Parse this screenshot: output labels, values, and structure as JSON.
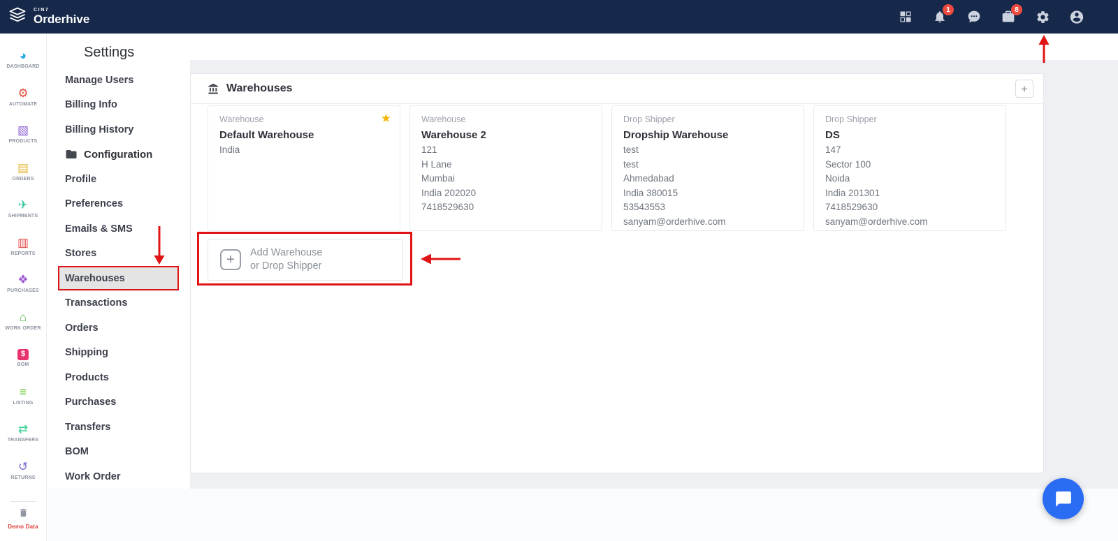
{
  "colors": {
    "topbar_bg": "#16294b",
    "annotation_red": "#e01414",
    "badge_red": "#ee4b40",
    "chat_widget_blue": "#2a6df4",
    "selected_item_bg": "#e4e4e5",
    "content_bg": "#eef0f4"
  },
  "topbar": {
    "brand_small": "CIN7",
    "brand": "Orderhive",
    "icons": [
      {
        "name": "apps-grid-icon"
      },
      {
        "name": "bell-icon",
        "badge": "1"
      },
      {
        "name": "chat-icon"
      },
      {
        "name": "package-icon",
        "badge": "8"
      },
      {
        "name": "gear-icon"
      },
      {
        "name": "account-icon"
      }
    ]
  },
  "rail": {
    "items": [
      {
        "label": "DASHBOARD",
        "icon": "dashboard-icon",
        "glyph": "◕",
        "color": "#2aabe4"
      },
      {
        "label": "AUTOMATE",
        "icon": "automate-icon",
        "glyph": "⚙",
        "color": "#e0533f"
      },
      {
        "label": "PRODUCTS",
        "icon": "products-icon",
        "glyph": "▧",
        "color": "#8b5fd6"
      },
      {
        "label": "ORDERS",
        "icon": "orders-icon",
        "glyph": "▤",
        "color": "#e8b93c"
      },
      {
        "label": "SHIPMENTS",
        "icon": "shipments-icon",
        "glyph": "✈",
        "color": "#35c4a4"
      },
      {
        "label": "REPORTS",
        "icon": "reports-icon",
        "glyph": "▥",
        "color": "#e34f4f"
      },
      {
        "label": "PURCHASES",
        "icon": "purchases-icon",
        "glyph": "❖",
        "color": "#9b59d0"
      },
      {
        "label": "WORK ORDER",
        "icon": "work-order-icon",
        "glyph": "⌂",
        "color": "#56b84b"
      },
      {
        "label": "BOM",
        "icon": "bom-icon",
        "glyph": "$",
        "color": "#e8356d"
      },
      {
        "label": "LISTING",
        "icon": "listing-icon",
        "glyph": "≡",
        "color": "#52c41a"
      },
      {
        "label": "TRANSFERS",
        "icon": "transfers-icon",
        "glyph": "⇄",
        "color": "#2ecc8f"
      },
      {
        "label": "RETURNS",
        "icon": "returns-icon",
        "glyph": "↺",
        "color": "#7c6bd8"
      }
    ],
    "demo": {
      "label": "Demo Data",
      "icon": "trash-icon",
      "color": "#e23b3b"
    }
  },
  "settings_nav": {
    "title": "Settings",
    "items": [
      {
        "label": "Manage Users"
      },
      {
        "label": "Billing Info"
      },
      {
        "label": "Billing History"
      },
      {
        "label": "Configuration",
        "icon": "folder-icon",
        "group": true
      },
      {
        "label": "Profile"
      },
      {
        "label": "Preferences"
      },
      {
        "label": "Emails & SMS"
      },
      {
        "label": "Stores"
      },
      {
        "label": "Warehouses",
        "selected": true
      },
      {
        "label": "Transactions"
      },
      {
        "label": "Orders"
      },
      {
        "label": "Shipping"
      },
      {
        "label": "Products"
      },
      {
        "label": "Purchases"
      },
      {
        "label": "Transfers"
      },
      {
        "label": "BOM"
      },
      {
        "label": "Work Order"
      }
    ]
  },
  "main": {
    "panel": {
      "title": "Warehouses",
      "icon": "warehouse-building-icon",
      "add_symbol": "+"
    },
    "cards": [
      {
        "type": "Warehouse",
        "name": "Default Warehouse",
        "starred": true,
        "lines": [
          "India"
        ]
      },
      {
        "type": "Warehouse",
        "name": "Warehouse 2",
        "lines": [
          "121",
          "H Lane",
          "Mumbai",
          "India 202020",
          "7418529630"
        ]
      },
      {
        "type": "Drop Shipper",
        "name": "Dropship Warehouse",
        "lines": [
          "test",
          "test",
          "Ahmedabad",
          "India 380015",
          "53543553",
          "sanyam@orderhive.com"
        ]
      },
      {
        "type": "Drop Shipper",
        "name": "DS",
        "lines": [
          "147",
          "Sector 100",
          "Noida",
          "India 201301",
          "7418529630",
          "sanyam@orderhive.com"
        ]
      }
    ],
    "add_card": {
      "plus": "+",
      "line1": "Add Warehouse",
      "line2": "or Drop Shipper"
    },
    "star_glyph": "★"
  }
}
